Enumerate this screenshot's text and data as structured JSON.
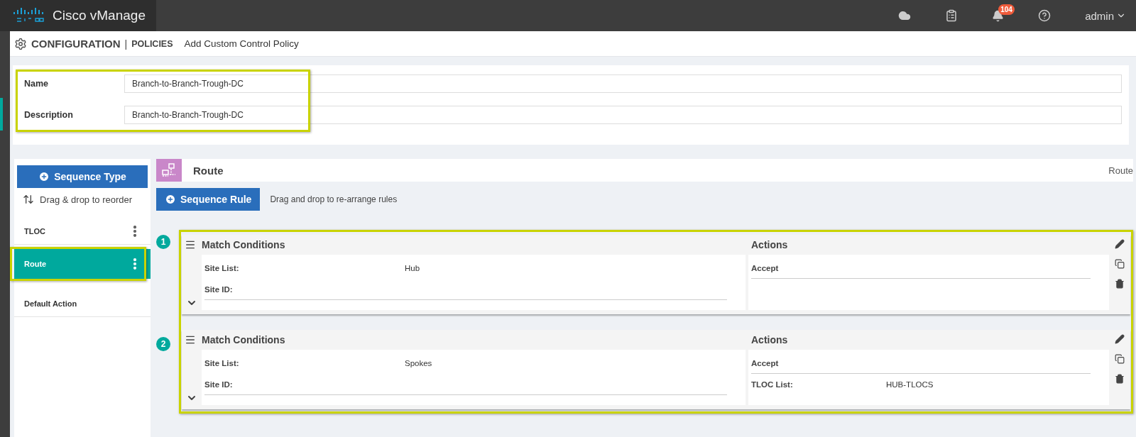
{
  "app": {
    "title": "Cisco vManage",
    "notifications": "104",
    "user": "admin"
  },
  "breadcrumb": {
    "section": "CONFIGURATION",
    "separator": "|",
    "subsection": "POLICIES",
    "page": "Add Custom Control Policy"
  },
  "form": {
    "highlighted": true,
    "fields": [
      {
        "label": "Name",
        "value": "Branch-to-Branch-Trough-DC"
      },
      {
        "label": "Description",
        "value": "Branch-to-Branch-Trough-DC"
      }
    ]
  },
  "sidebar": {
    "button": "Sequence Type",
    "hint": "Drag & drop to reorder",
    "items": [
      {
        "label": "TLOC",
        "selected": false,
        "highlighted": false,
        "menu": true
      },
      {
        "label": "Route",
        "selected": true,
        "highlighted": true,
        "menu": true
      },
      {
        "label": "Default Action",
        "selected": false,
        "highlighted": false,
        "menu": false
      }
    ]
  },
  "sequence": {
    "title": "Route",
    "type": "Route",
    "button": "Sequence Rule",
    "hint": "Drag and drop to re-arrange rules",
    "highlighted": true,
    "rules": [
      {
        "number": "1",
        "match_title": "Match Conditions",
        "actions_title": "Actions",
        "matches": [
          {
            "label": "Site List:",
            "value": "Hub"
          },
          {
            "label": "Site ID:"
          }
        ],
        "actions": [
          {
            "label": "Accept"
          }
        ]
      },
      {
        "number": "2",
        "match_title": "Match Conditions",
        "actions_title": "Actions",
        "matches": [
          {
            "label": "Site List:",
            "value": "Spokes"
          },
          {
            "label": "Site ID:"
          }
        ],
        "actions": [
          {
            "label": "Accept"
          },
          {
            "label": "TLOC List:",
            "value": "HUB-TLOCS"
          }
        ]
      }
    ]
  }
}
